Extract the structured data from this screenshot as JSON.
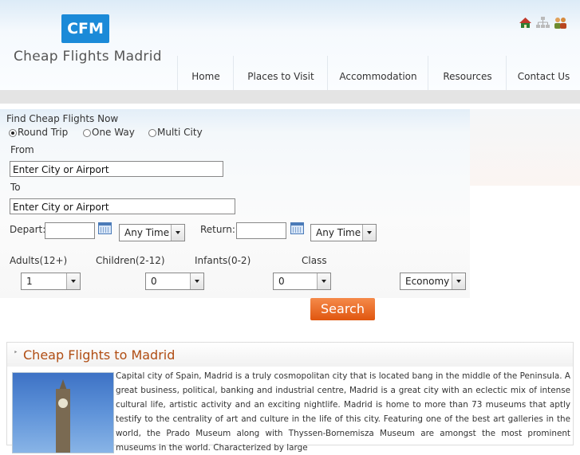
{
  "header": {
    "logo_text": "CFM",
    "site_name": "Cheap Flights Madrid",
    "icons": [
      "home-icon",
      "sitemap-icon",
      "contact-people-icon"
    ]
  },
  "nav": {
    "items": [
      "Home",
      "Places to Visit",
      "Accommodation",
      "Resources",
      "Contact Us"
    ]
  },
  "search_form": {
    "heading": "Find Cheap Flights Now",
    "trip_types": [
      {
        "label": "Round Trip",
        "selected": true
      },
      {
        "label": "One Way",
        "selected": false
      },
      {
        "label": "Multi City",
        "selected": false
      }
    ],
    "from_label": "From",
    "from_value": "Enter City or Airport",
    "to_label": "To",
    "to_value": "Enter City or Airport",
    "depart_label": "Depart:",
    "depart_value": "",
    "depart_time": "Any Time",
    "return_label": "Return:",
    "return_value": "",
    "return_time": "Any Time",
    "adults_label": "Adults(12+)",
    "adults_value": "1",
    "children_label": "Children(2-12)",
    "children_value": "0",
    "infants_label": "Infants(0-2)",
    "infants_value": "0",
    "class_label": "Class",
    "class_value": "Economy",
    "search_label": "Search"
  },
  "article": {
    "title": "Cheap Flights to Madrid",
    "body": "Capital city of Spain, Madrid is a truly cosmopolitan city that is located bang in the middle of the Peninsula. A great business, political, banking and industrial centre, Madrid is a great city with an eclectic mix of intense cultural life, artistic activity and an exciting nightlife. Madrid is home to more than 73 museums that aptly testify to the centrality of art and culture in the life of this city. Featuring one of the best art galleries in the world, the Prado Museum along with Thyssen-Bornemisza Museum are amongst the most prominent museums in the world. Characterized by large"
  }
}
